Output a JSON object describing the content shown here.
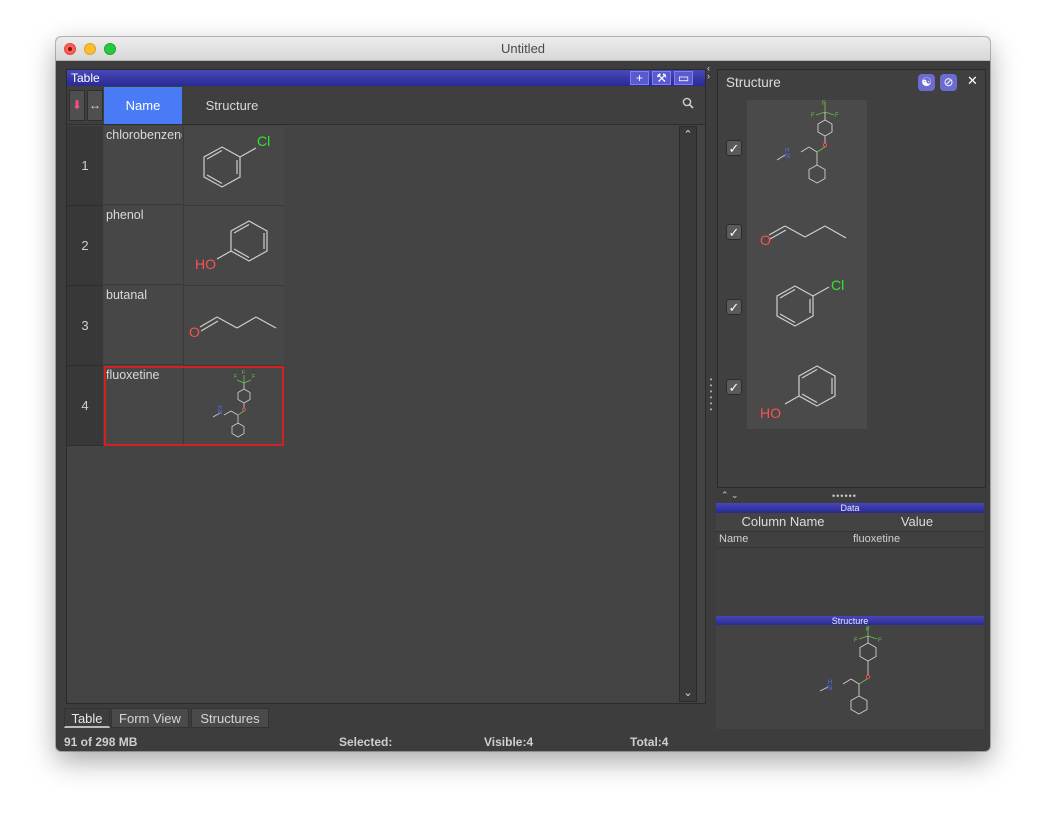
{
  "window": {
    "title": "Untitled"
  },
  "table_panel": {
    "title": "Table",
    "header_buttons": [
      "+",
      "⚒",
      "▭"
    ],
    "columns": {
      "name": "Name",
      "structure": "Structure"
    },
    "rows": [
      {
        "num": "1",
        "name": "chlorobenzene"
      },
      {
        "num": "2",
        "name": "phenol"
      },
      {
        "num": "3",
        "name": "butanal"
      },
      {
        "num": "4",
        "name": "fluoxetine"
      }
    ],
    "atom_labels": {
      "cl": "Cl",
      "ho": "HO",
      "o": "O",
      "f": "F",
      "n": "N",
      "h": "H"
    }
  },
  "tabs": [
    "Table",
    "Form View",
    "Structures"
  ],
  "status": {
    "memory": "91 of 298 MB",
    "selected": "Selected:",
    "visible": "Visible:4",
    "total": "Total:4"
  },
  "structure_panel": {
    "title": "Structure"
  },
  "data_panel": {
    "title": "Data",
    "col_name_header": "Column Name",
    "value_header": "Value",
    "rows": [
      {
        "name": "Name",
        "value": "fluoxetine"
      }
    ]
  },
  "structure_pane": {
    "title": "Structure"
  },
  "colors": {
    "selection_header": "#4a7bf7",
    "panel_header": "#2a2a94",
    "chlorine": "#2ee82e",
    "oxygen": "#ff5050",
    "fluorine": "#6cc04a",
    "nitrogen": "#5070ff",
    "selection_border": "#d42020"
  }
}
